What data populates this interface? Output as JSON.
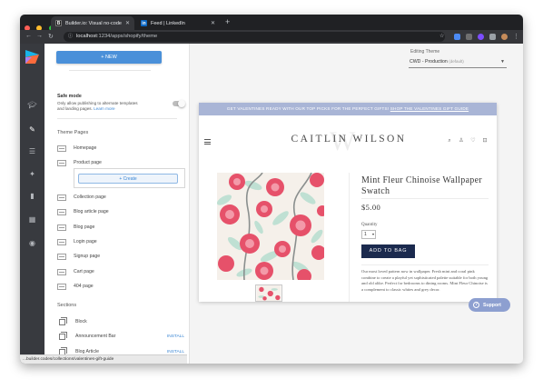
{
  "browser": {
    "tabs": [
      {
        "label": "Builder.io: Visual no-code con",
        "icon": "builder-icon",
        "active": true
      },
      {
        "label": "Feed | LinkedIn",
        "icon": "linkedin-icon",
        "active": false
      }
    ],
    "url_host": "localhost",
    "url_path": ":1234/apps/shopify/theme",
    "status_url": "...builder.codes/collections/valentines-gift-guide"
  },
  "sidebar": {
    "new_button": "+ NEW",
    "safe_mode": {
      "title": "Safe mode",
      "desc": "Only allow publishing to alternate templates and landing pages.",
      "link": "Learn more"
    },
    "theme_pages_heading": "Theme Pages",
    "pages": [
      "Homepage",
      "Product page",
      "Collection page",
      "Blog article page",
      "Blog page",
      "Login page",
      "Signup page",
      "Cart page",
      "404 page"
    ],
    "create_button": "+ Create",
    "sections_heading": "Sections",
    "sections": [
      {
        "label": "Block",
        "action": ""
      },
      {
        "label": "Announcement Bar",
        "action": "INSTALL"
      },
      {
        "label": "Blog Article",
        "action": "INSTALL"
      }
    ]
  },
  "editing_theme": {
    "label": "Editing Theme",
    "value": "CWD - Production",
    "tag": "(default)"
  },
  "preview": {
    "announcement": "GET VALENTINES READY WITH OUR TOP PICKS FOR THE PERFECT GIFTS!",
    "announcement_link": "SHOP THE VALENTINES GIFT GUIDE",
    "brand": "CAITLIN WILSON",
    "watermark": "W",
    "product_title": "Mint Fleur Chinoise Wallpaper Swatch",
    "price": "$5.00",
    "quantity_label": "Quantity",
    "quantity_value": "1",
    "add_to_bag": "ADD TO BAG",
    "description": "Our most loved pattern now in wallpaper. Fresh mint and coral pink combine to create a playful yet sophisticated palette suitable for both young and old alike. Perfect for bedrooms to dining rooms. Mint Fleur Chinoise is a complement to classic whites and grey decor."
  },
  "support_label": "Support",
  "colors": {
    "accent_blue": "#4a90d9",
    "announcement_bg": "#a9b5d6",
    "add_to_bag_bg": "#1b2a4e",
    "rail_bg": "#383a3f"
  }
}
